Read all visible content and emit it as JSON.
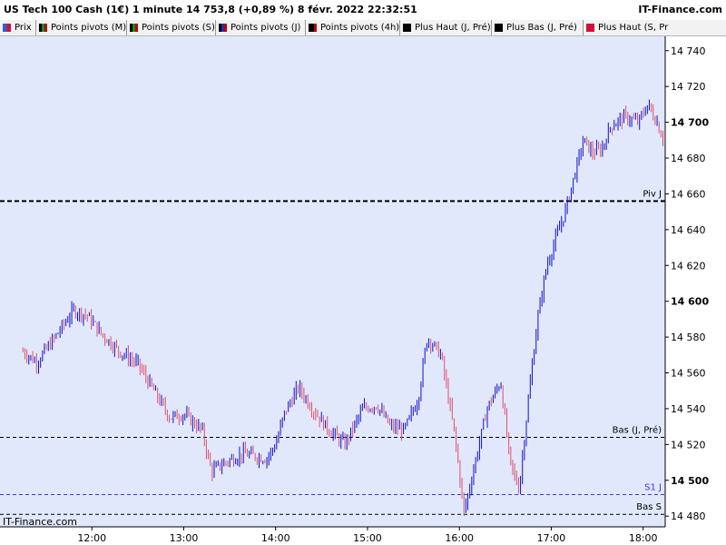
{
  "header": {
    "title": "US Tech 100 Cash (1€) 1 minute 14 753,8 (+0,89 %) 8 févr. 2022 22:32:51",
    "brand": "IT-Finance.com"
  },
  "legend": [
    {
      "label": "Prix",
      "color": "#2f5fd0",
      "icon": "candle-swatch"
    },
    {
      "label": "Points pivots (M)",
      "color": "#1a8a1a",
      "icon": "pivot-swatch"
    },
    {
      "label": "Points pivots (S)",
      "color": "#1a8a1a",
      "icon": "pivot-swatch"
    },
    {
      "label": "Points pivots (J)",
      "color": "#2a2ab0",
      "icon": "pivot-swatch"
    },
    {
      "label": "Points pivots (4h)",
      "color": "#000000",
      "icon": "pivot-swatch"
    },
    {
      "label": "Plus Haut (J, Pré)",
      "color": "#000000",
      "icon": "level-swatch"
    },
    {
      "label": "Plus Bas (J, Pré)",
      "color": "#000000",
      "icon": "level-swatch"
    },
    {
      "label": "Plus Haut (S, Pr",
      "color": "#d0103a",
      "icon": "level-swatch"
    }
  ],
  "watermark": "IT-Finance.com",
  "colors": {
    "plot_bg": "#e1e8fc",
    "up": "#1010c8",
    "down": "#e0506a"
  },
  "chart_data": {
    "type": "candlestick",
    "title": "US Tech 100 Cash (1€) 1 minute",
    "x_ticks": [
      "12:00",
      "13:00",
      "14:00",
      "15:00",
      "16:00",
      "17:00",
      "18:00"
    ],
    "y_ticks": [
      14480,
      14500,
      14520,
      14540,
      14560,
      14580,
      14600,
      14620,
      14640,
      14660,
      14680,
      14700,
      14720,
      14740
    ],
    "ylim": [
      14474,
      14748
    ],
    "last_price": 14753.8,
    "change_pct": "+0,89 %",
    "levels": [
      {
        "label": "Piv J",
        "value": 14656,
        "color": "#000000",
        "style": "thick-dashed"
      },
      {
        "label": "Bas (J, Pré)",
        "value": 14524,
        "color": "#000000",
        "style": "dashed"
      },
      {
        "label": "S1 J",
        "value": 14492,
        "color": "#3a3ac8",
        "style": "dashed"
      },
      {
        "label": "Bas S",
        "value": 14481,
        "color": "#000000",
        "style": "dashed"
      }
    ],
    "price_path": [
      [
        11.25,
        14572
      ],
      [
        11.4,
        14566
      ],
      [
        11.6,
        14580
      ],
      [
        11.8,
        14595
      ],
      [
        11.95,
        14592
      ],
      [
        12.1,
        14582
      ],
      [
        12.3,
        14572
      ],
      [
        12.5,
        14565
      ],
      [
        12.65,
        14552
      ],
      [
        12.85,
        14535
      ],
      [
        13.0,
        14537
      ],
      [
        13.2,
        14528
      ],
      [
        13.3,
        14505
      ],
      [
        13.45,
        14510
      ],
      [
        13.65,
        14515
      ],
      [
        13.9,
        14512
      ],
      [
        14.0,
        14520
      ],
      [
        14.1,
        14538
      ],
      [
        14.25,
        14552
      ],
      [
        14.4,
        14540
      ],
      [
        14.55,
        14530
      ],
      [
        14.75,
        14520
      ],
      [
        14.95,
        14540
      ],
      [
        15.1,
        14542
      ],
      [
        15.25,
        14530
      ],
      [
        15.4,
        14528
      ],
      [
        15.55,
        14545
      ],
      [
        15.65,
        14580
      ],
      [
        15.8,
        14570
      ],
      [
        15.95,
        14525
      ],
      [
        16.05,
        14482
      ],
      [
        16.15,
        14505
      ],
      [
        16.3,
        14540
      ],
      [
        16.45,
        14555
      ],
      [
        16.55,
        14510
      ],
      [
        16.65,
        14495
      ],
      [
        16.75,
        14545
      ],
      [
        16.85,
        14590
      ],
      [
        16.95,
        14620
      ],
      [
        17.05,
        14635
      ],
      [
        17.15,
        14650
      ],
      [
        17.25,
        14670
      ],
      [
        17.35,
        14690
      ],
      [
        17.45,
        14683
      ],
      [
        17.55,
        14685
      ],
      [
        17.65,
        14698
      ],
      [
        17.8,
        14703
      ],
      [
        17.95,
        14700
      ],
      [
        18.05,
        14710
      ],
      [
        18.15,
        14700
      ],
      [
        18.22,
        14690
      ]
    ]
  }
}
